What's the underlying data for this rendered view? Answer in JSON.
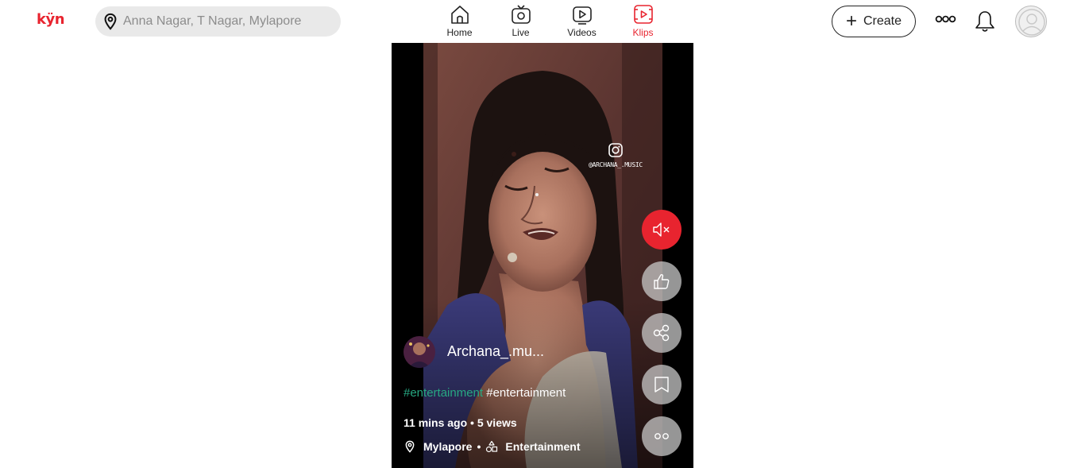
{
  "header": {
    "logo": "kÿn",
    "search_placeholder": "Anna Nagar, T Nagar, Mylapore",
    "nav": [
      {
        "label": "Home",
        "icon": "home-icon"
      },
      {
        "label": "Live",
        "icon": "live-tv-icon"
      },
      {
        "label": "Videos",
        "icon": "video-play-icon"
      },
      {
        "label": "Klips",
        "icon": "klips-icon",
        "active": true
      }
    ],
    "create_label": "Create"
  },
  "klip": {
    "watermark": "@ARCHANA_.MUSIC",
    "username": "Archana_.mu...",
    "hashtag_1": "#entertainment",
    "hashtag_2": "#entertainment",
    "time_ago": "11 mins ago",
    "views": "5 views",
    "location": "Mylapore",
    "category": "Entertainment"
  },
  "actions": [
    "mute-icon",
    "like-icon",
    "share-icon",
    "bookmark-icon",
    "more-icon"
  ],
  "colors": {
    "brand_red": "#e8242f",
    "hashtag_green": "#27a882",
    "search_bg": "#e9e9e9"
  }
}
